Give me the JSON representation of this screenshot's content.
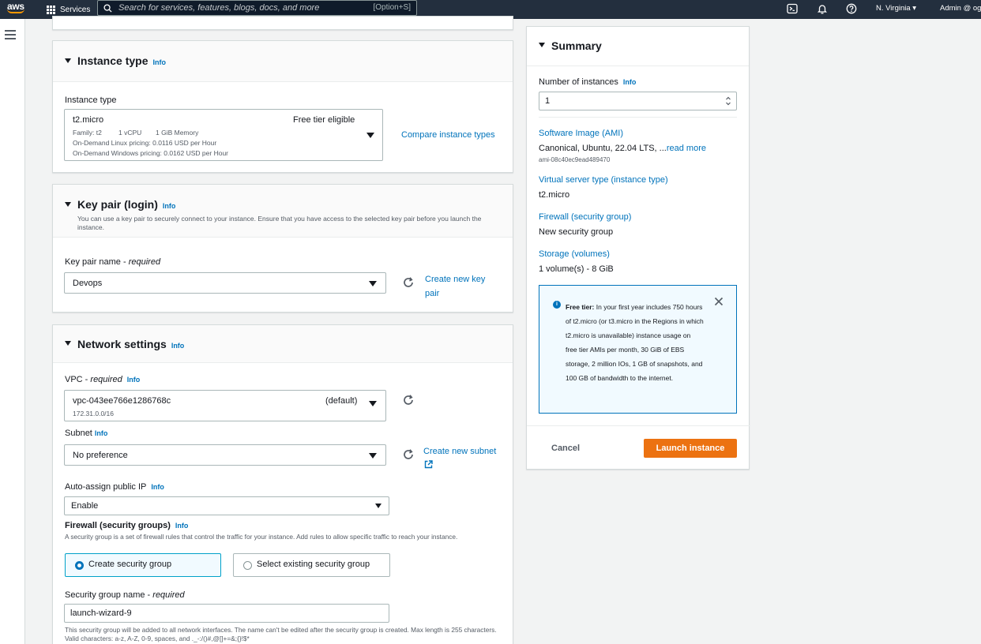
{
  "topnav": {
    "logo_text": "aws",
    "services_label": "Services",
    "search_placeholder": "Search for services, features, blogs, docs, and more",
    "search_shortcut": "[Option+S]",
    "region": "N. Virginia ▾",
    "account": "Admin @ og"
  },
  "instance_type": {
    "title": "Instance type",
    "info": "Info",
    "field_label": "Instance type",
    "selected": "t2.micro",
    "badge": "Free tier eligible",
    "family": "Family: t2",
    "vcpu": "1 vCPU",
    "memory": "1 GiB Memory",
    "linux_pricing": "On-Demand Linux pricing: 0.0116 USD per Hour",
    "windows_pricing": "On-Demand Windows pricing: 0.0162 USD per Hour",
    "compare_link": "Compare instance types"
  },
  "key_pair": {
    "title": "Key pair (login)",
    "info": "Info",
    "description": "You can use a key pair to securely connect to your instance. Ensure that you have access to the selected key pair before you launch the instance.",
    "field_label": "Key pair name",
    "required": "required",
    "selected": "Devops",
    "create_link": "Create new key pair"
  },
  "network": {
    "title": "Network settings",
    "info": "Info",
    "vpc_label": "VPC",
    "vpc_required": "required",
    "vpc_info": "Info",
    "vpc_value": "vpc-043ee766e1286768c",
    "vpc_default": "(default)",
    "vpc_cidr": "172.31.0.0/16",
    "subnet_label": "Subnet",
    "subnet_info": "Info",
    "subnet_value": "No preference",
    "create_subnet_link": "Create new subnet",
    "public_ip_label": "Auto-assign public IP",
    "public_ip_info": "Info",
    "public_ip_value": "Enable",
    "firewall_label": "Firewall (security groups)",
    "firewall_info": "Info",
    "firewall_desc": "A security group is a set of firewall rules that control the traffic for your instance. Add rules to allow specific traffic to reach your instance.",
    "radio_create": "Create security group",
    "radio_existing": "Select existing security group",
    "sg_name_label": "Security group name",
    "sg_name_required": "required",
    "sg_name_value": "launch-wizard-9",
    "sg_name_help": "This security group will be added to all network interfaces. The name can't be edited after the security group is created. Max length is 255 characters. Valid characters: a-z, A-Z, 0-9, spaces, and ._-:/()#,@[]+=&;{}!$*"
  },
  "summary": {
    "title": "Summary",
    "instances_label": "Number of instances",
    "instances_info": "Info",
    "instances_value": "1",
    "ami_label": "Software Image (AMI)",
    "ami_value": "Canonical, Ubuntu, 22.04 LTS, ...",
    "ami_read_more": "read more",
    "ami_id": "ami-08c40ec9ead489470",
    "server_type_label": "Virtual server type (instance type)",
    "server_type_value": "t2.micro",
    "firewall_label": "Firewall (security group)",
    "firewall_value": "New security group",
    "storage_label": "Storage (volumes)",
    "storage_value": "1 volume(s) - 8 GiB",
    "free_tier_bold": "Free tier:",
    "free_tier_text": "In your first year includes 750 hours of t2.micro (or t3.micro in the Regions in which t2.micro is unavailable) instance usage on free tier AMIs per month, 30 GiB of EBS storage, 2 million IOs, 1 GB of snapshots, and 100 GB of bandwidth to the internet.",
    "cancel_label": "Cancel",
    "launch_label": "Launch instance"
  }
}
